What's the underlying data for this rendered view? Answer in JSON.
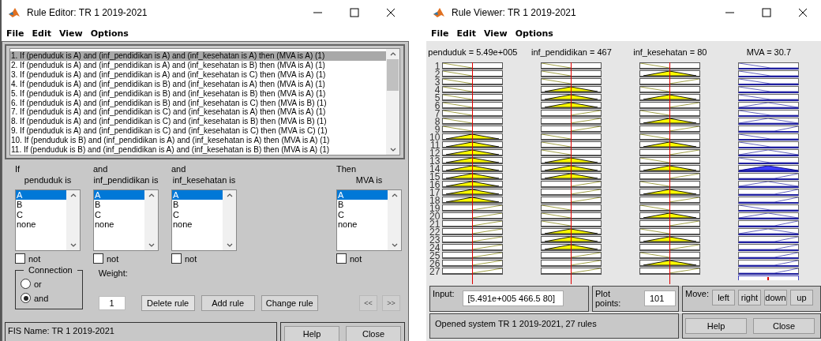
{
  "rule_editor": {
    "title": "Rule Editor: TR 1 2019-2021",
    "menu": [
      "File",
      "Edit",
      "View",
      "Options"
    ],
    "rules": [
      {
        "text": "1. If (penduduk is A) and (inf_pendidikan is A) and (inf_kesehatan is A) then (MVA is A) (1)",
        "selected": true
      },
      {
        "text": "2. If (penduduk is A) and (inf_pendidikan is A) and (inf_kesehatan is B) then (MVA is A) (1)",
        "selected": false
      },
      {
        "text": "3. If (penduduk is A) and (inf_pendidikan is A) and (inf_kesehatan is C) then (MVA is A) (1)",
        "selected": false
      },
      {
        "text": "4. If (penduduk is A) and (inf_pendidikan is B) and (inf_kesehatan is A) then (MVA is A) (1)",
        "selected": false
      },
      {
        "text": "5. If (penduduk is A) and (inf_pendidikan is B) and (inf_kesehatan is B) then (MVA is A) (1)",
        "selected": false
      },
      {
        "text": "6. If (penduduk is A) and (inf_pendidikan is B) and (inf_kesehatan is C) then (MVA is B) (1)",
        "selected": false
      },
      {
        "text": "7. If (penduduk is A) and (inf_pendidikan is C) and (inf_kesehatan is A) then (MVA is A) (1)",
        "selected": false
      },
      {
        "text": "8. If (penduduk is A) and (inf_pendidikan is C) and (inf_kesehatan is B) then (MVA is B) (1)",
        "selected": false
      },
      {
        "text": "9. If (penduduk is A) and (inf_pendidikan is C) and (inf_kesehatan is C) then (MVA is C) (1)",
        "selected": false
      },
      {
        "text": "10. If (penduduk is B) and (inf_pendidikan is A) and (inf_kesehatan is A) then (MVA is A) (1)",
        "selected": false
      },
      {
        "text": "11. If (penduduk is B) and (inf_pendidikan is A) and (inf_kesehatan is B) then (MVA is A) (1)",
        "selected": false
      }
    ],
    "clauses": [
      {
        "connector": "If",
        "variable": "penduduk is",
        "options": [
          {
            "label": "A",
            "selected": true
          },
          {
            "label": "B",
            "selected": false
          },
          {
            "label": "C",
            "selected": false
          },
          {
            "label": "none",
            "selected": false
          }
        ],
        "not": {
          "label": "not",
          "checked": false
        }
      },
      {
        "connector": "and",
        "variable": "inf_pendidikan is",
        "options": [
          {
            "label": "A",
            "selected": true
          },
          {
            "label": "B",
            "selected": false
          },
          {
            "label": "C",
            "selected": false
          },
          {
            "label": "none",
            "selected": false
          }
        ],
        "not": {
          "label": "not",
          "checked": false
        }
      },
      {
        "connector": "and",
        "variable": "inf_kesehatan is",
        "options": [
          {
            "label": "A",
            "selected": true
          },
          {
            "label": "B",
            "selected": false
          },
          {
            "label": "C",
            "selected": false
          },
          {
            "label": "none",
            "selected": false
          }
        ],
        "not": {
          "label": "not",
          "checked": false
        }
      },
      {
        "connector": "Then",
        "variable": "MVA is",
        "options": [
          {
            "label": "A",
            "selected": true
          },
          {
            "label": "B",
            "selected": false
          },
          {
            "label": "C",
            "selected": false
          },
          {
            "label": "none",
            "selected": false
          }
        ],
        "not": {
          "label": "not",
          "checked": false
        }
      }
    ],
    "connection": {
      "title": "Connection",
      "options": [
        {
          "label": "or",
          "selected": false
        },
        {
          "label": "and",
          "selected": true
        }
      ]
    },
    "weight": {
      "label": "Weight:",
      "value": "1"
    },
    "buttons": [
      "Delete rule",
      "Add rule",
      "Change rule"
    ],
    "nav_buttons": [
      {
        "label": "<<",
        "disabled": true
      },
      {
        "label": ">>",
        "disabled": true
      }
    ],
    "fis_name": "FIS Name: TR 1 2019-2021",
    "footer_buttons": [
      "Help",
      "Close"
    ]
  },
  "rule_viewer": {
    "title": "Rule Viewer: TR 1 2019-2021",
    "menu": [
      "File",
      "Edit",
      "View",
      "Options"
    ],
    "variables": [
      {
        "label": "penduduk = 5.49e+005",
        "kind": "input",
        "level": 0.49
      },
      {
        "label": "inf_pendidikan = 467",
        "kind": "input",
        "level": 0.49
      },
      {
        "label": "inf_kesehatan = 80",
        "kind": "input",
        "level": 0.49
      },
      {
        "label": "MVA = 30.7",
        "kind": "output",
        "level": 0.48
      }
    ],
    "rows": [
      {
        "number": "1",
        "cells": [
          {
            "kind": "A",
            "fired": false
          },
          {
            "kind": "A",
            "fired": false
          },
          {
            "kind": "A",
            "fired": false
          },
          {
            "kind": "A",
            "fired": false
          }
        ]
      },
      {
        "number": "2",
        "cells": [
          {
            "kind": "A",
            "fired": false
          },
          {
            "kind": "A",
            "fired": false
          },
          {
            "kind": "B",
            "fired": true
          },
          {
            "kind": "A",
            "fired": false
          }
        ]
      },
      {
        "number": "3",
        "cells": [
          {
            "kind": "A",
            "fired": false
          },
          {
            "kind": "A",
            "fired": false
          },
          {
            "kind": "C",
            "fired": false
          },
          {
            "kind": "A",
            "fired": false
          }
        ]
      },
      {
        "number": "4",
        "cells": [
          {
            "kind": "A",
            "fired": false
          },
          {
            "kind": "B",
            "fired": true
          },
          {
            "kind": "A",
            "fired": false
          },
          {
            "kind": "A",
            "fired": false
          }
        ]
      },
      {
        "number": "5",
        "cells": [
          {
            "kind": "A",
            "fired": false
          },
          {
            "kind": "B",
            "fired": true
          },
          {
            "kind": "B",
            "fired": true
          },
          {
            "kind": "A",
            "fired": false
          }
        ]
      },
      {
        "number": "6",
        "cells": [
          {
            "kind": "A",
            "fired": false
          },
          {
            "kind": "B",
            "fired": true
          },
          {
            "kind": "C",
            "fired": false
          },
          {
            "kind": "B",
            "fired": false
          }
        ]
      },
      {
        "number": "7",
        "cells": [
          {
            "kind": "A",
            "fired": false
          },
          {
            "kind": "C",
            "fired": false
          },
          {
            "kind": "A",
            "fired": false
          },
          {
            "kind": "A",
            "fired": false
          }
        ]
      },
      {
        "number": "8",
        "cells": [
          {
            "kind": "A",
            "fired": false
          },
          {
            "kind": "C",
            "fired": false
          },
          {
            "kind": "B",
            "fired": true
          },
          {
            "kind": "B",
            "fired": false
          }
        ]
      },
      {
        "number": "9",
        "cells": [
          {
            "kind": "A",
            "fired": false
          },
          {
            "kind": "C",
            "fired": false
          },
          {
            "kind": "C",
            "fired": false
          },
          {
            "kind": "C",
            "fired": false
          }
        ]
      },
      {
        "number": "10",
        "cells": [
          {
            "kind": "B",
            "fired": true
          },
          {
            "kind": "A",
            "fired": false
          },
          {
            "kind": "A",
            "fired": false
          },
          {
            "kind": "A",
            "fired": false
          }
        ]
      },
      {
        "number": "11",
        "cells": [
          {
            "kind": "B",
            "fired": true
          },
          {
            "kind": "A",
            "fired": false
          },
          {
            "kind": "B",
            "fired": true
          },
          {
            "kind": "A",
            "fired": false
          }
        ]
      },
      {
        "number": "12",
        "cells": [
          {
            "kind": "B",
            "fired": true
          },
          {
            "kind": "A",
            "fired": false
          },
          {
            "kind": "C",
            "fired": false
          },
          {
            "kind": "B",
            "fired": false
          }
        ]
      },
      {
        "number": "13",
        "cells": [
          {
            "kind": "B",
            "fired": true
          },
          {
            "kind": "B",
            "fired": true
          },
          {
            "kind": "A",
            "fired": false
          },
          {
            "kind": "A",
            "fired": false
          }
        ]
      },
      {
        "number": "14",
        "cells": [
          {
            "kind": "B",
            "fired": true
          },
          {
            "kind": "B",
            "fired": true
          },
          {
            "kind": "B",
            "fired": true
          },
          {
            "kind": "B",
            "fired": true
          }
        ]
      },
      {
        "number": "15",
        "cells": [
          {
            "kind": "B",
            "fired": true
          },
          {
            "kind": "B",
            "fired": true
          },
          {
            "kind": "C",
            "fired": false
          },
          {
            "kind": "C",
            "fired": false
          }
        ]
      },
      {
        "number": "16",
        "cells": [
          {
            "kind": "B",
            "fired": true
          },
          {
            "kind": "C",
            "fired": false
          },
          {
            "kind": "A",
            "fired": false
          },
          {
            "kind": "B",
            "fired": false
          }
        ]
      },
      {
        "number": "17",
        "cells": [
          {
            "kind": "B",
            "fired": true
          },
          {
            "kind": "C",
            "fired": false
          },
          {
            "kind": "B",
            "fired": true
          },
          {
            "kind": "C",
            "fired": false
          }
        ]
      },
      {
        "number": "18",
        "cells": [
          {
            "kind": "B",
            "fired": true
          },
          {
            "kind": "C",
            "fired": false
          },
          {
            "kind": "C",
            "fired": false
          },
          {
            "kind": "C",
            "fired": false
          }
        ]
      },
      {
        "number": "19",
        "cells": [
          {
            "kind": "C",
            "fired": false
          },
          {
            "kind": "A",
            "fired": false
          },
          {
            "kind": "A",
            "fired": false
          },
          {
            "kind": "A",
            "fired": false
          }
        ]
      },
      {
        "number": "20",
        "cells": [
          {
            "kind": "C",
            "fired": false
          },
          {
            "kind": "A",
            "fired": false
          },
          {
            "kind": "B",
            "fired": true
          },
          {
            "kind": "B",
            "fired": false
          }
        ]
      },
      {
        "number": "21",
        "cells": [
          {
            "kind": "C",
            "fired": false
          },
          {
            "kind": "A",
            "fired": false
          },
          {
            "kind": "C",
            "fired": false
          },
          {
            "kind": "C",
            "fired": false
          }
        ]
      },
      {
        "number": "22",
        "cells": [
          {
            "kind": "C",
            "fired": false
          },
          {
            "kind": "B",
            "fired": true
          },
          {
            "kind": "A",
            "fired": false
          },
          {
            "kind": "B",
            "fired": false
          }
        ]
      },
      {
        "number": "23",
        "cells": [
          {
            "kind": "C",
            "fired": false
          },
          {
            "kind": "B",
            "fired": true
          },
          {
            "kind": "B",
            "fired": true
          },
          {
            "kind": "C",
            "fired": false
          }
        ]
      },
      {
        "number": "24",
        "cells": [
          {
            "kind": "C",
            "fired": false
          },
          {
            "kind": "B",
            "fired": true
          },
          {
            "kind": "C",
            "fired": false
          },
          {
            "kind": "C",
            "fired": false
          }
        ]
      },
      {
        "number": "25",
        "cells": [
          {
            "kind": "C",
            "fired": false
          },
          {
            "kind": "C",
            "fired": false
          },
          {
            "kind": "A",
            "fired": false
          },
          {
            "kind": "C",
            "fired": false
          }
        ]
      },
      {
        "number": "26",
        "cells": [
          {
            "kind": "C",
            "fired": false
          },
          {
            "kind": "C",
            "fired": false
          },
          {
            "kind": "B",
            "fired": true
          },
          {
            "kind": "C",
            "fired": false
          }
        ]
      },
      {
        "number": "27",
        "cells": [
          {
            "kind": "C",
            "fired": false
          },
          {
            "kind": "C",
            "fired": false
          },
          {
            "kind": "C",
            "fired": false
          },
          {
            "kind": "C",
            "fired": false
          }
        ]
      }
    ],
    "input": {
      "label": "Input:",
      "value": "[5.491e+005 466.5 80]"
    },
    "plot_points": {
      "label": "Plot points:",
      "value": "101"
    },
    "move": {
      "label": "Move:",
      "buttons": [
        "left",
        "right",
        "down",
        "up"
      ]
    },
    "status": "Opened system TR 1 2019-2021, 27 rules",
    "footer_buttons": [
      "Help",
      "Close"
    ]
  }
}
